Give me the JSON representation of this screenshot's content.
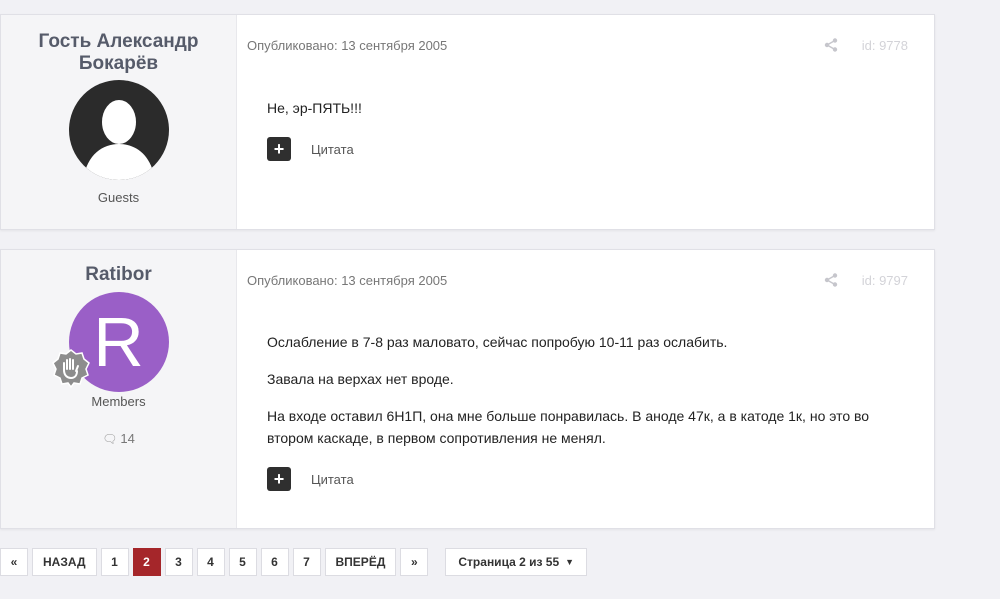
{
  "posts": [
    {
      "author": "Гость Александр Бокарёв",
      "group": "Guests",
      "meta": "Опубликовано: 13 сентября 2005",
      "id": "id: 9778",
      "paragraphs": [
        "Не, эр-ПЯТЬ!!!"
      ],
      "quote_label": "Цитата"
    },
    {
      "author": "Ratibor",
      "avatar_letter": "R",
      "avatar_color": "#9a5fc7",
      "group": "Members",
      "post_count": "14",
      "meta": "Опубликовано: 13 сентября 2005",
      "id": "id: 9797",
      "paragraphs": [
        "Ослабление в 7-8 раз маловато, сейчас попробую 10-11 раз ослабить.",
        "Завала на верхах нет вроде.",
        "На входе оставил 6Н1П, она мне больше понравилась. В аноде 47к, а в катоде 1к, но это во втором каскаде, в первом сопротивления не менял."
      ],
      "quote_label": "Цитата"
    }
  ],
  "pagination": {
    "first": "«",
    "prev": "НАЗАД",
    "pages": [
      "1",
      "2",
      "3",
      "4",
      "5",
      "6",
      "7"
    ],
    "current": "2",
    "next": "ВПЕРЁД",
    "last": "»",
    "jump": "Страница 2 из 55"
  },
  "icons": {
    "share": "share-icon",
    "comment": "comment-icon",
    "plus": "plus-icon",
    "dropdown": "caret-down-icon",
    "rank": "hand-badge-icon"
  },
  "colors": {
    "accent": "#a5262a",
    "author_name": "#565b6a",
    "avatar_guest": "#2b2b2b"
  }
}
